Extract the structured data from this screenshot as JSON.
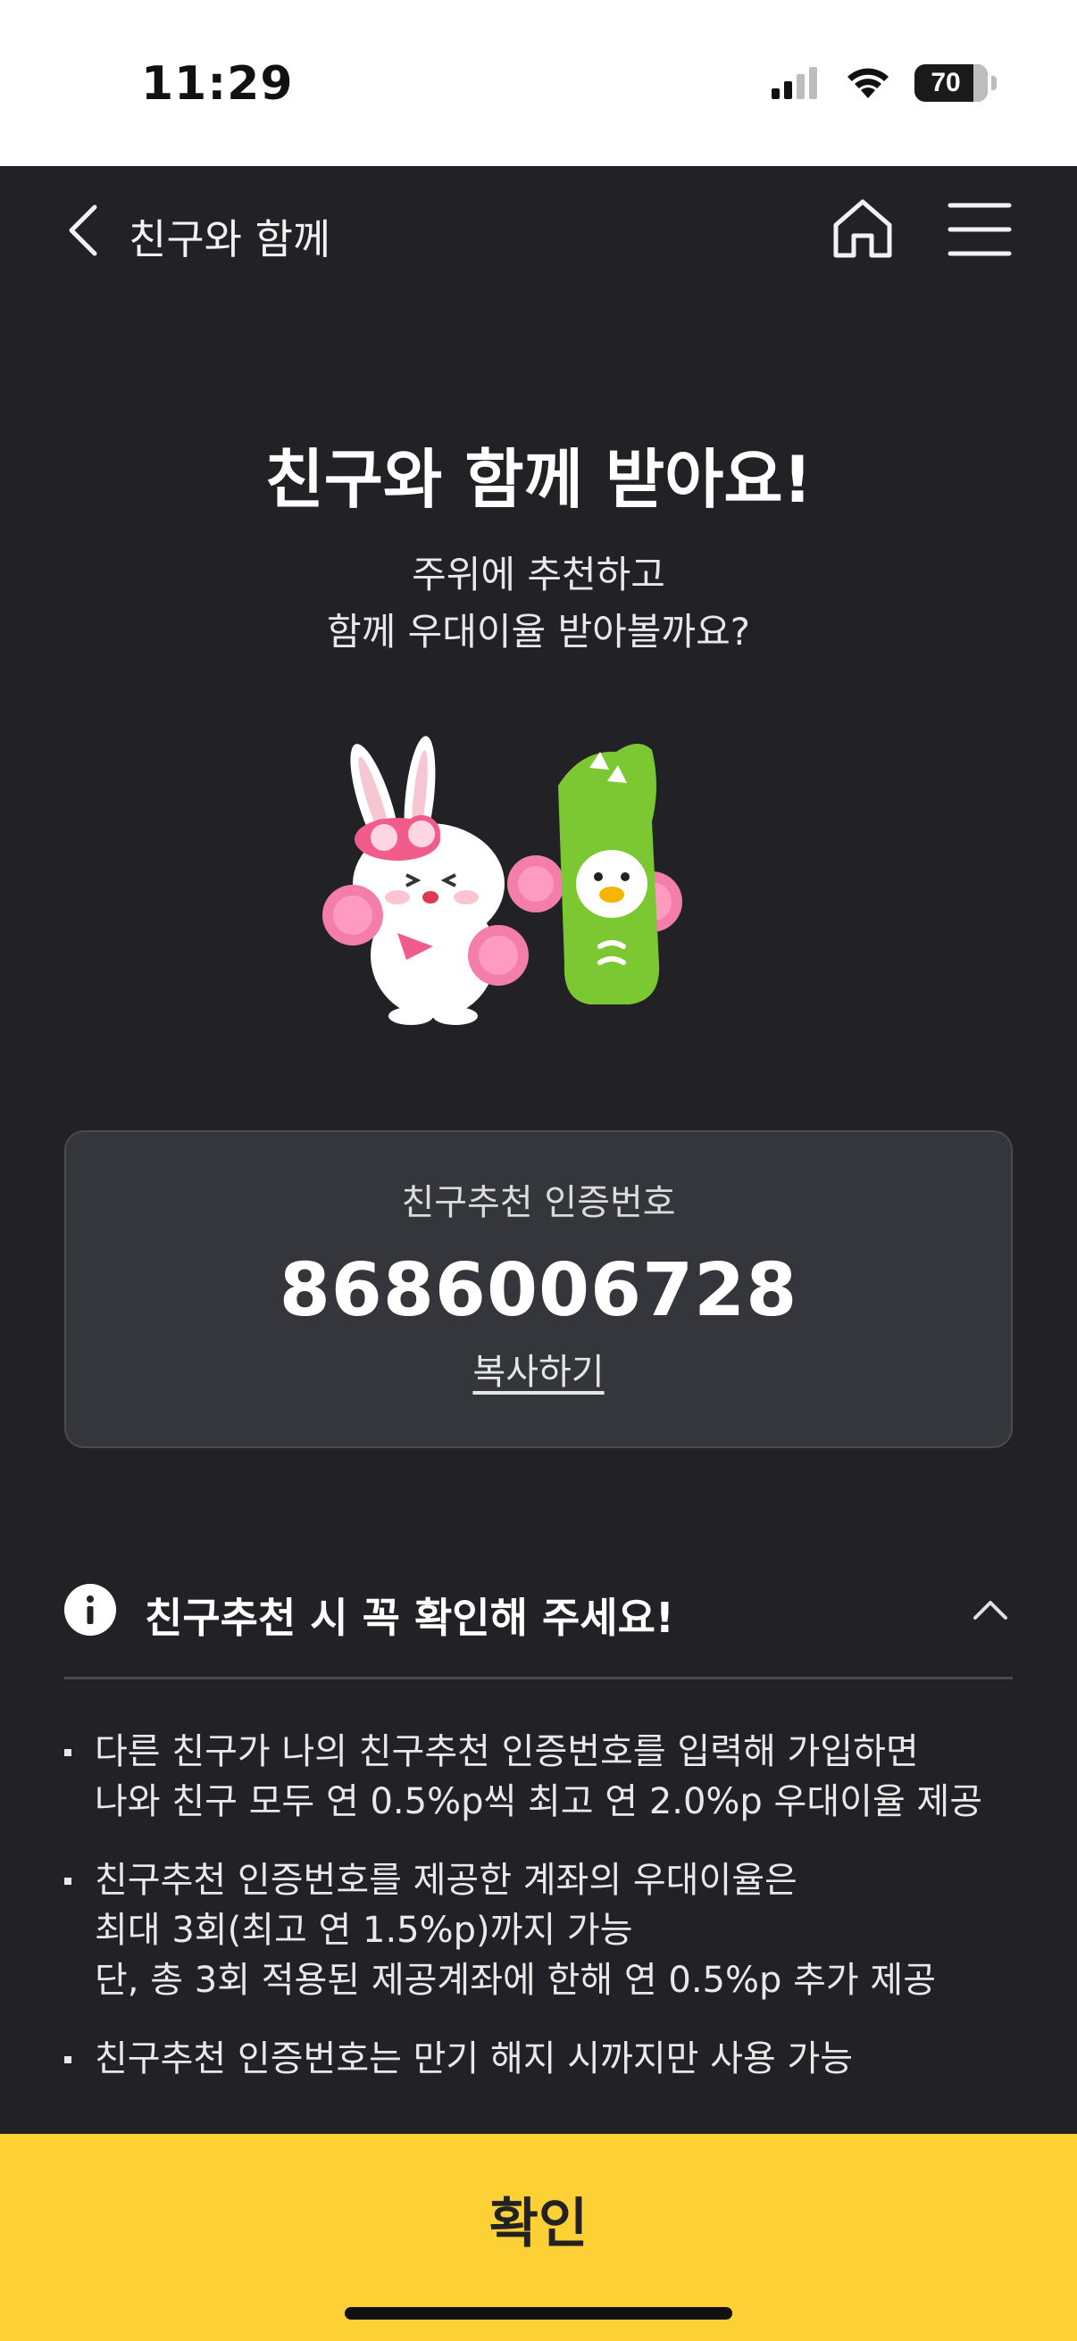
{
  "status_bar": {
    "time": "11:29",
    "battery": "70",
    "icons": [
      "signal-icon",
      "wifi-icon",
      "battery-icon"
    ]
  },
  "nav": {
    "title": "친구와 함께",
    "icons": [
      "back-arrow-icon",
      "home-icon",
      "menu-icon"
    ]
  },
  "hero": {
    "title": "친구와 함께 받아요!",
    "subtitle_line1": "주위에 추천하고",
    "subtitle_line2": "함께 우대이율 받아볼까요?"
  },
  "code_card": {
    "label": "친구추천 인증번호",
    "code": "8686006728",
    "copy_label": "복사하기"
  },
  "notice": {
    "title": "친구추천 시 꼭 확인해 주세요!",
    "items": [
      {
        "line1": "다른 친구가 나의 친구추천 인증번호를 입력해 가입하면",
        "line2": "나와 친구 모두 연 0.5%p씩 최고 연 2.0%p 우대이율 제공"
      },
      {
        "line1": "친구추천 인증번호를 제공한 계좌의 우대이율은",
        "line2": "최대 3회(최고 연 1.5%p)까지 가능",
        "line3": "단, 총 3회 적용된 제공계좌에 한해 연 0.5%p 추가 제공"
      },
      {
        "line1": "친구추천 인증번호는 만기 해지 시까지만 사용 가능"
      }
    ]
  },
  "confirm_button": {
    "label": "확인"
  },
  "colors": {
    "background": "#222226",
    "card": "#35363b",
    "accent_yellow": "#fdd036",
    "text_primary": "#ffffff"
  }
}
